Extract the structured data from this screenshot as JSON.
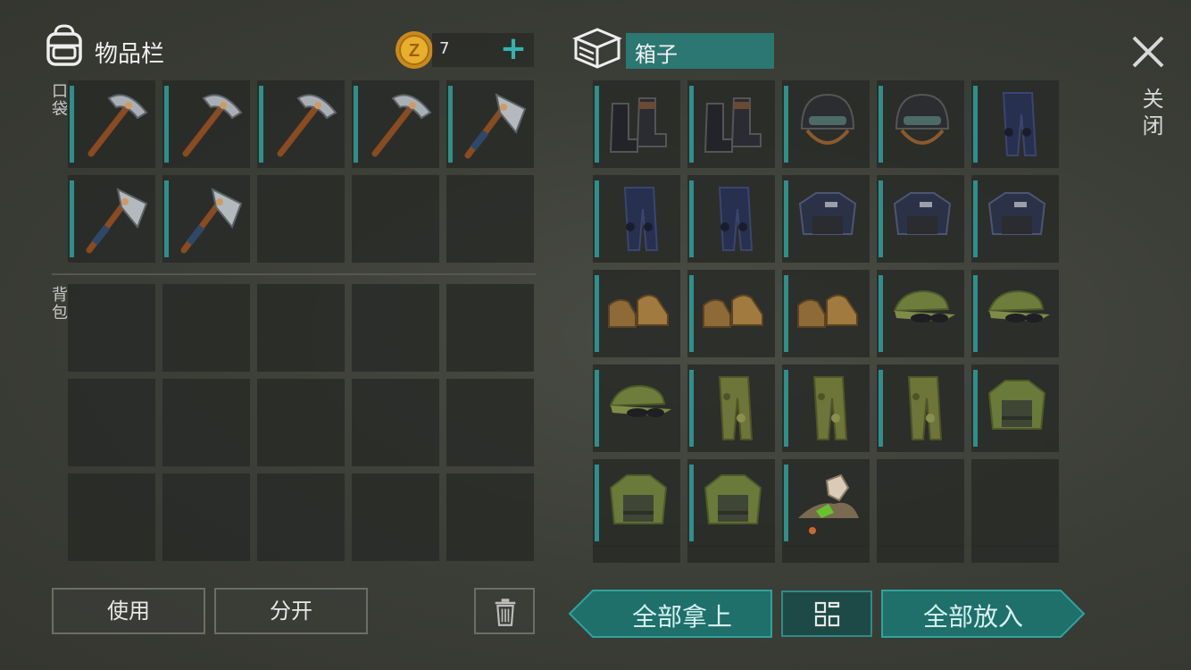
{
  "inventory": {
    "title": "物品栏",
    "coins": "7",
    "pocket_label": "口袋",
    "backpack_label": "背包",
    "pocket_slots": [
      "pickaxe",
      "pickaxe",
      "pickaxe",
      "pickaxe",
      "hatchet",
      "hatchet",
      "hatchet",
      "",
      "",
      ""
    ],
    "backpack_slots": [
      "",
      "",
      "",
      "",
      "",
      "",
      "",
      "",
      "",
      "",
      "",
      "",
      "",
      "",
      ""
    ]
  },
  "actions": {
    "use_label": "使用",
    "split_label": "分开"
  },
  "container": {
    "title": "箱子",
    "slots": [
      "police-boots",
      "police-boots",
      "riot-helmet",
      "riot-helmet",
      "police-pants",
      "police-pants",
      "police-pants",
      "police-vest",
      "police-vest",
      "police-vest",
      "tan-boots",
      "tan-boots",
      "tan-boots",
      "camo-cap",
      "camo-cap",
      "camo-cap",
      "camo-pants",
      "camo-pants",
      "camo-pants",
      "camo-jacket",
      "camo-jacket",
      "camo-jacket",
      "resource-pile",
      "",
      ""
    ],
    "take_all_label": "全部拿上",
    "put_all_label": "全部放入"
  },
  "close_label": "关闭",
  "colors": {
    "accent": "#2c7772",
    "teal_button": "#1f7d78",
    "background": "#3b3d37"
  }
}
